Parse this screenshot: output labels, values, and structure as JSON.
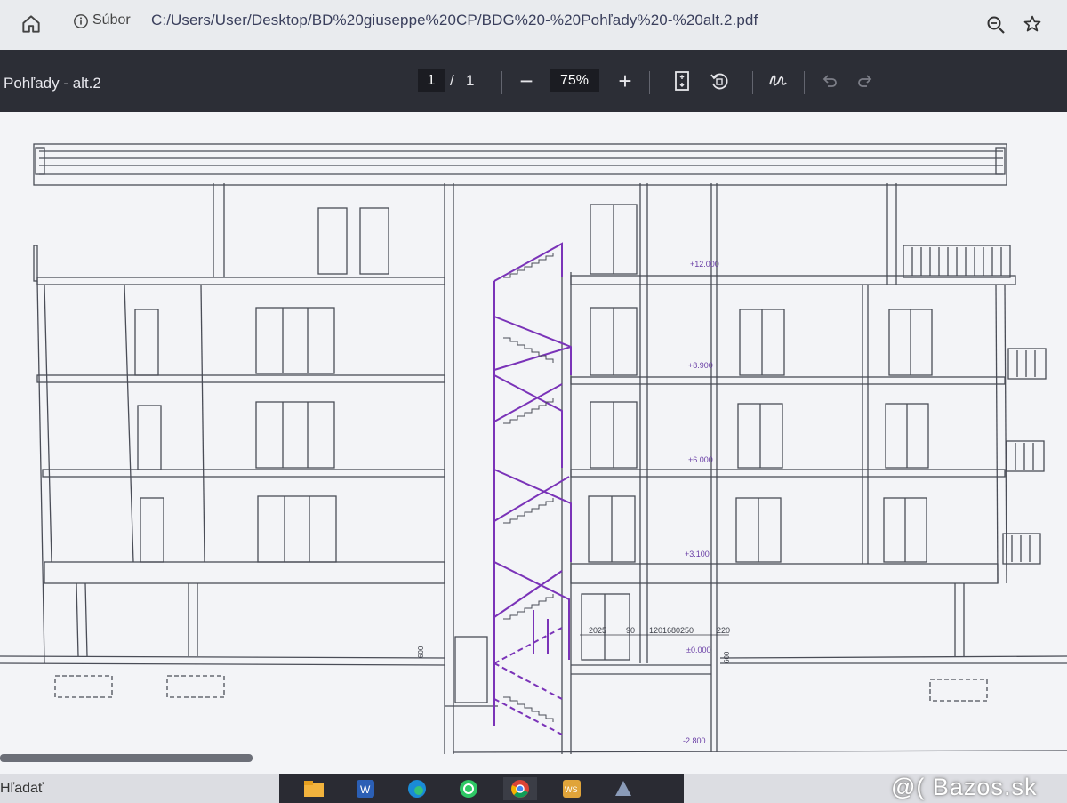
{
  "browser": {
    "file_label": "Súbor",
    "url": "C:/Users/User/Desktop/BD%20giuseppe%20CP/BDG%20-%20Pohľady%20-%20alt.2.pdf"
  },
  "pdf_toolbar": {
    "doc_title": "Pohľady - alt.2",
    "page_current": "1",
    "page_separator": "/",
    "page_total": "1",
    "zoom_out": "−",
    "zoom_level": "75%",
    "zoom_in": "+"
  },
  "drawing": {
    "levels": [
      "+12.000",
      "+8.900",
      "+6.000",
      "+3.100",
      "±0.000",
      "-2.800"
    ],
    "dimensions": [
      "2025",
      "90",
      "1201680250",
      "220",
      "600",
      "600"
    ],
    "colors": {
      "line": "#4a4d57",
      "stair": "#7a33b8",
      "paper": "#f3f4f7"
    }
  },
  "taskbar": {
    "search_label": "Hľadať",
    "apps": [
      "file-explorer-icon",
      "word-icon",
      "edge-icon",
      "whatsapp-icon",
      "chrome-icon",
      "wps-icon",
      "app-icon"
    ]
  },
  "watermark": "@( Bazos.sk"
}
